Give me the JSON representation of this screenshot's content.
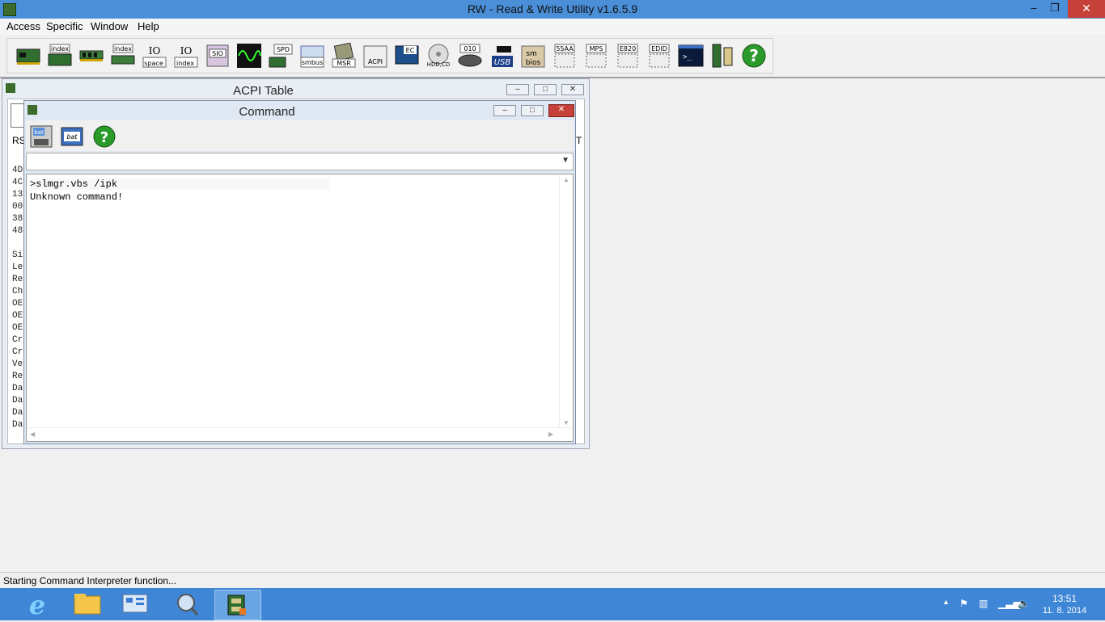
{
  "window": {
    "title": "RW - Read & Write Utility v1.6.5.9",
    "min": "–",
    "max": "❐",
    "close": "✕"
  },
  "menu": [
    "Access",
    "Specific",
    "Window",
    "Help"
  ],
  "toolbar": {
    "icons": [
      "pci-icon",
      "pci-index-icon",
      "memory-icon",
      "memory-index-icon",
      "io-space-icon",
      "io-index-icon",
      "sio-icon",
      "waveform-icon",
      "spd-icon",
      "smbus-icon",
      "msr-icon",
      "acpi-icon",
      "ec-icon",
      "hdd-cd-icon",
      "cmos-icon",
      "usb-icon",
      "smbios-icon",
      "55aa-icon",
      "mps-icon",
      "e820-icon",
      "edid-icon",
      "command-icon",
      "pci-bus-icon",
      "help-icon"
    ],
    "labels": [
      "",
      "index",
      "",
      "index",
      "space",
      "index",
      "SIO",
      "",
      "SPD",
      "smbus",
      "MSR",
      "ACPI",
      "EC",
      "HDD,CD",
      "010",
      "USB",
      "sm bios",
      "55AA",
      "MPS",
      "E820",
      "EDID",
      "",
      "",
      "?"
    ]
  },
  "acpi_window": {
    "title": "ACPI Table",
    "tab_label": "RS",
    "tab_label_right": "T",
    "hex_lines": [
      "4D",
      "4C",
      "13",
      "00",
      "38",
      "48"
    ],
    "field_lines": [
      "Si",
      "Le",
      "Re",
      "Ch",
      "OE",
      "OE",
      "OE",
      "Cr",
      "Cr",
      "Ve",
      "Re",
      "Da",
      "Da",
      "Da",
      "Da"
    ]
  },
  "command_window": {
    "title": "Command",
    "toolbar_labels": [
      "bat",
      "bat",
      "?"
    ],
    "console_lines": [
      ">slmgr.vbs /ipk",
      "Unknown command!"
    ],
    "combo_value": ""
  },
  "status": {
    "text": "Starting Command Interpreter function..."
  },
  "taskbar": {
    "time": "13:51",
    "date": "11. 8. 2014"
  },
  "colors": {
    "titlebar": "#4a8fd8",
    "taskbar": "#3f87d6",
    "close": "#c7413b"
  }
}
